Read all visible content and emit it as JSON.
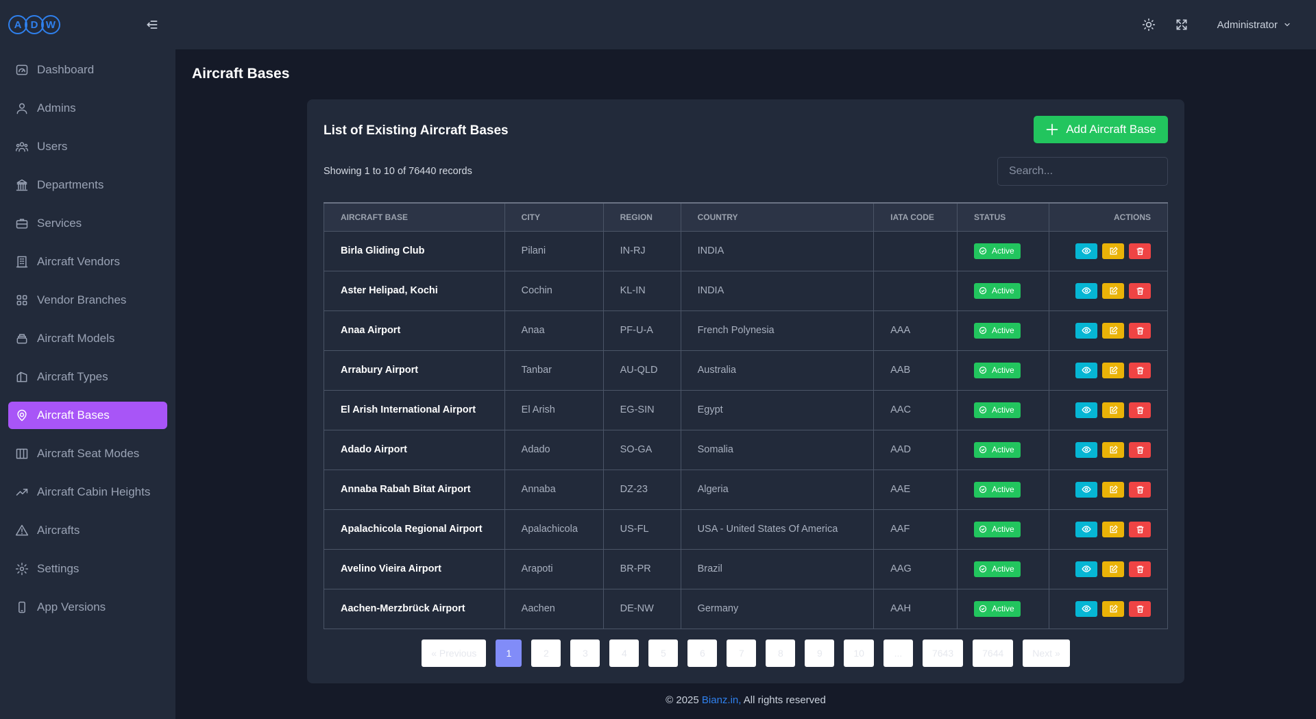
{
  "logo": {
    "letters": [
      "A",
      "D",
      "W"
    ]
  },
  "sidebar": {
    "items": [
      {
        "label": "Dashboard",
        "icon": "dashboard-gauge-icon"
      },
      {
        "label": "Admins",
        "icon": "user-icon"
      },
      {
        "label": "Users",
        "icon": "users-group-icon"
      },
      {
        "label": "Departments",
        "icon": "building-bank-icon"
      },
      {
        "label": "Services",
        "icon": "briefcase-icon"
      },
      {
        "label": "Aircraft Vendors",
        "icon": "building-icon"
      },
      {
        "label": "Vendor Branches",
        "icon": "grid-icon"
      },
      {
        "label": "Aircraft Models",
        "icon": "layers-icon"
      },
      {
        "label": "Aircraft Types",
        "icon": "tag-icon"
      },
      {
        "label": "Aircraft Bases",
        "icon": "map-pin-icon",
        "active": true
      },
      {
        "label": "Aircraft Seat Modes",
        "icon": "columns-icon"
      },
      {
        "label": "Aircraft Cabin Heights",
        "icon": "trending-up-icon"
      },
      {
        "label": "Aircrafts",
        "icon": "triangle-icon"
      },
      {
        "label": "Settings",
        "icon": "gear-icon"
      },
      {
        "label": "App Versions",
        "icon": "smartphone-icon"
      }
    ]
  },
  "header": {
    "user": "Administrator"
  },
  "page": {
    "title": "Aircraft Bases"
  },
  "card": {
    "title": "List of Existing Aircraft Bases",
    "add_button": "Add Aircraft Base",
    "records_text": "Showing 1 to 10 of 76440 records",
    "search_placeholder": "Search..."
  },
  "table": {
    "columns": [
      "AIRCRAFT BASE",
      "CITY",
      "REGION",
      "COUNTRY",
      "IATA CODE",
      "STATUS",
      "ACTIONS"
    ],
    "rows": [
      {
        "base": "Birla Gliding Club",
        "city": "Pilani",
        "region": "IN-RJ",
        "country": "INDIA",
        "iata": "",
        "status": "Active"
      },
      {
        "base": "Aster Helipad, Kochi",
        "city": "Cochin",
        "region": "KL-IN",
        "country": "INDIA",
        "iata": "",
        "status": "Active"
      },
      {
        "base": "Anaa Airport",
        "city": "Anaa",
        "region": "PF-U-A",
        "country": "French Polynesia",
        "iata": "AAA",
        "status": "Active"
      },
      {
        "base": "Arrabury Airport",
        "city": "Tanbar",
        "region": "AU-QLD",
        "country": "Australia",
        "iata": "AAB",
        "status": "Active"
      },
      {
        "base": "El Arish International Airport",
        "city": "El Arish",
        "region": "EG-SIN",
        "country": "Egypt",
        "iata": "AAC",
        "status": "Active"
      },
      {
        "base": "Adado Airport",
        "city": "Adado",
        "region": "SO-GA",
        "country": "Somalia",
        "iata": "AAD",
        "status": "Active"
      },
      {
        "base": "Annaba Rabah Bitat Airport",
        "city": "Annaba",
        "region": "DZ-23",
        "country": "Algeria",
        "iata": "AAE",
        "status": "Active"
      },
      {
        "base": "Apalachicola Regional Airport",
        "city": "Apalachicola",
        "region": "US-FL",
        "country": "USA - United States Of America",
        "iata": "AAF",
        "status": "Active"
      },
      {
        "base": "Avelino Vieira Airport",
        "city": "Arapoti",
        "region": "BR-PR",
        "country": "Brazil",
        "iata": "AAG",
        "status": "Active"
      },
      {
        "base": "Aachen-Merzbrück Airport",
        "city": "Aachen",
        "region": "DE-NW",
        "country": "Germany",
        "iata": "AAH",
        "status": "Active"
      }
    ]
  },
  "pagination": {
    "items": [
      "« Previous",
      "1",
      "2",
      "3",
      "4",
      "5",
      "6",
      "7",
      "8",
      "9",
      "10",
      "...",
      "7643",
      "7644",
      "Next »"
    ],
    "active": "1"
  },
  "footer": {
    "prefix": "© 2025 ",
    "link": "Bianz.in,",
    "suffix": " All rights reserved"
  },
  "colors": {
    "accent": "#a855f7",
    "success": "#22c55e",
    "info": "#06b6d4",
    "warning": "#eab308",
    "danger": "#ef4444",
    "page_active": "#818cf8"
  }
}
